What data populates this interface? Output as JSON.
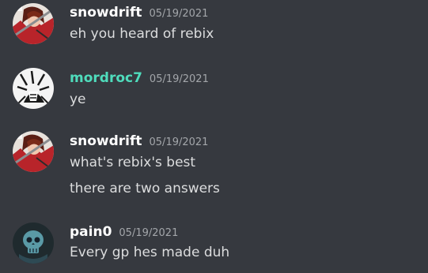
{
  "colors": {
    "background": "#36393f",
    "username_default": "#ffffff",
    "username_teal": "#4fdcbc",
    "timestamp": "#a3a6aa",
    "message_text": "#dcddde"
  },
  "messages": [
    {
      "author": "snowdrift",
      "timestamp": "05/19/2021",
      "avatar_icon": "anime-character-avatar-icon",
      "lines": [
        "eh you heard of rebix"
      ]
    },
    {
      "author": "mordroc7",
      "timestamp": "05/19/2021",
      "avatar_icon": "manga-sketch-avatar-icon",
      "lines": [
        "ye"
      ]
    },
    {
      "author": "snowdrift",
      "timestamp": "05/19/2021",
      "avatar_icon": "anime-character-avatar-icon",
      "lines": [
        "what's rebix's best",
        "there are two answers"
      ]
    },
    {
      "author": "pain0",
      "timestamp": "05/19/2021",
      "avatar_icon": "blue-skull-avatar-icon",
      "lines": [
        "Every gp hes made duh"
      ]
    }
  ]
}
